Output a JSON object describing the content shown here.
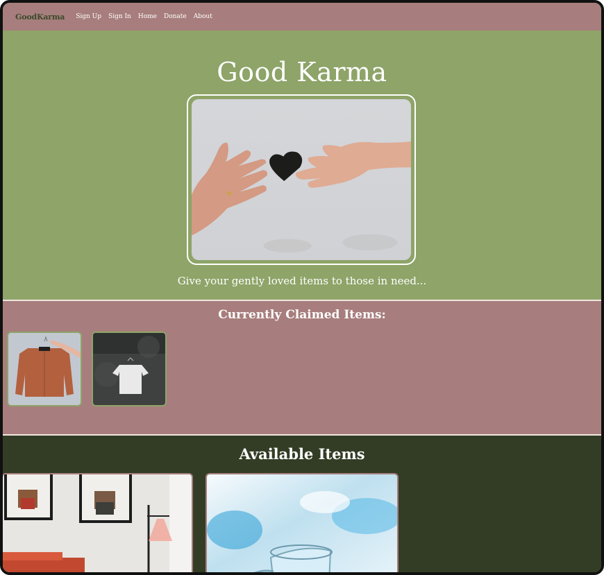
{
  "nav": {
    "brand": "GoodKarma",
    "links": [
      "Sign Up",
      "Sign In",
      "Home",
      "Donate",
      "About"
    ]
  },
  "hero": {
    "title": "Good Karma",
    "subtitle": "Give your gently loved items to those in need...",
    "image_alt": "hands-passing-heart-photo"
  },
  "claimed": {
    "title": "Currently Claimed Items:",
    "items": [
      "jacket-on-hanger-photo",
      "white-tshirt-on-hanger-photo"
    ]
  },
  "available": {
    "title": "Available Items",
    "items": [
      "deer-art-prints-room-photo",
      "glass-measuring-cup-photo"
    ]
  },
  "colors": {
    "nav_bg": "#a77e7d",
    "hero_bg": "#8ea468",
    "available_bg": "#333d25",
    "brand_text": "#3a4a2a"
  }
}
